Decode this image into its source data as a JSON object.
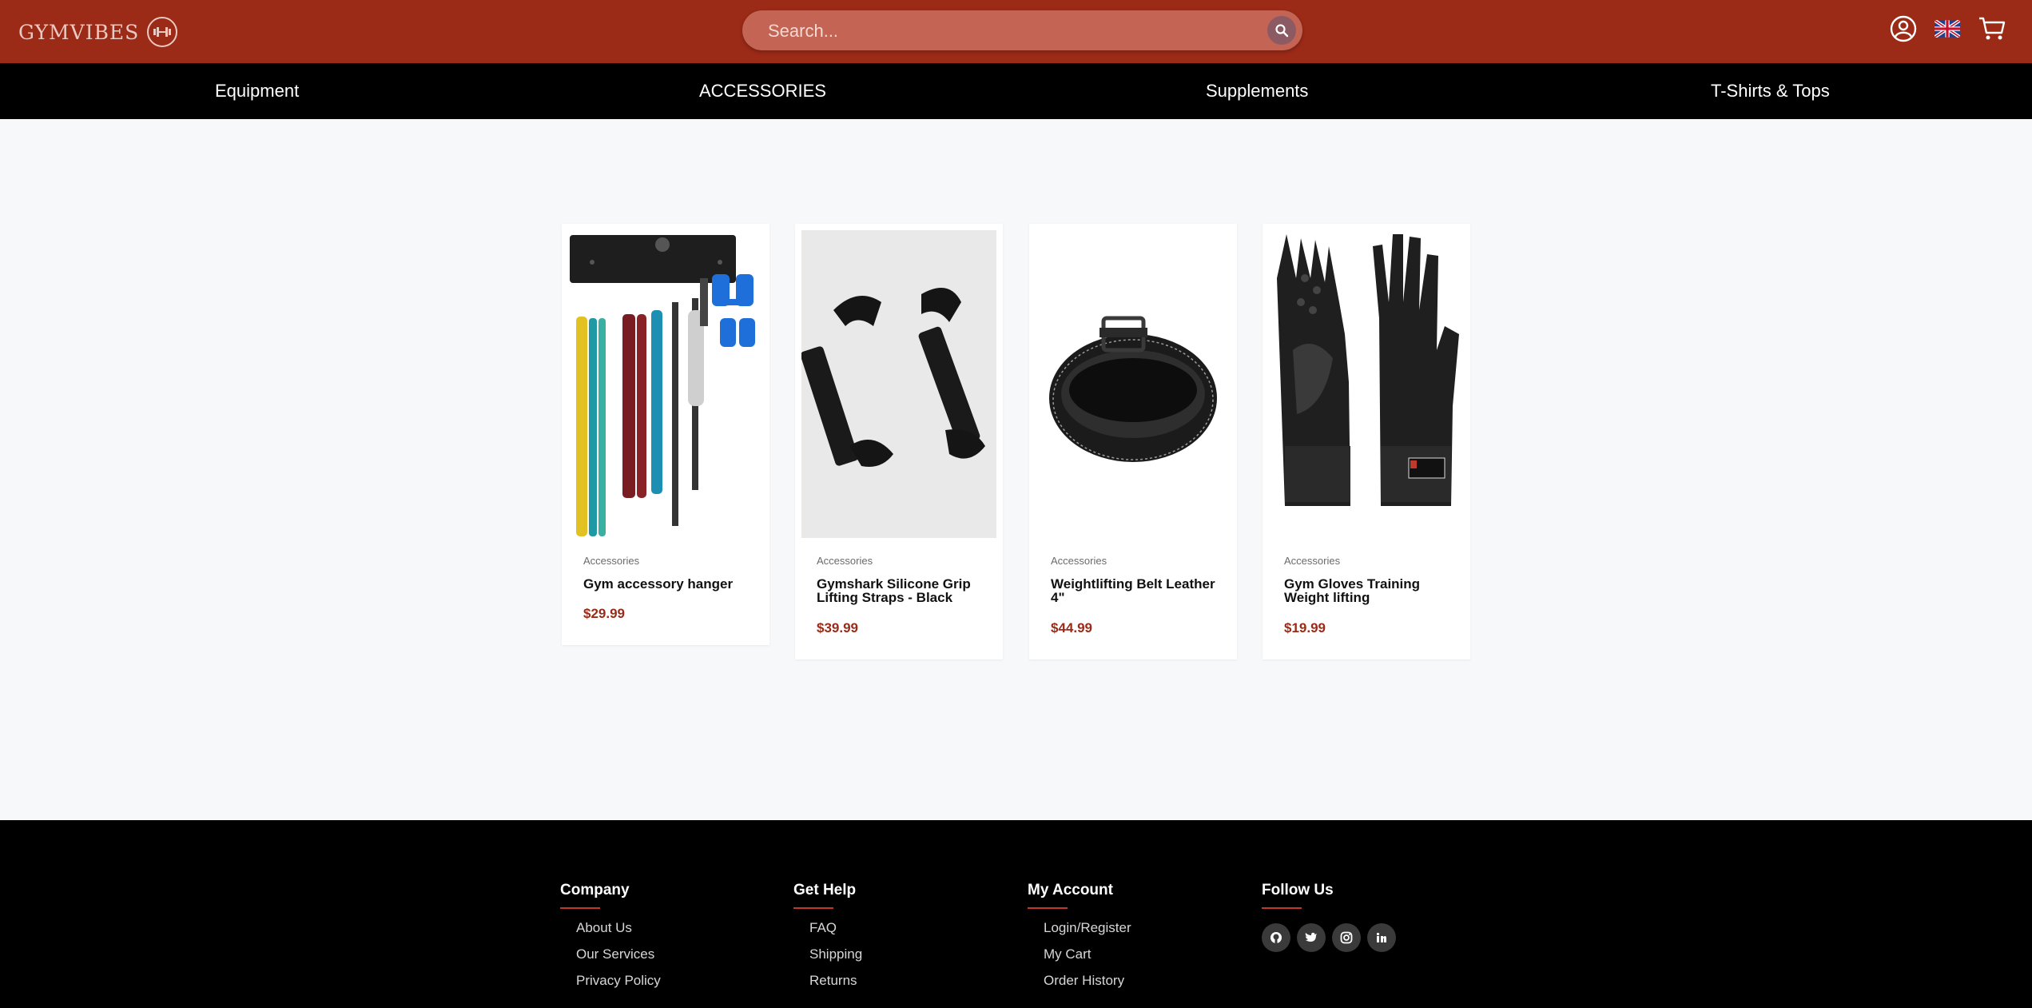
{
  "header": {
    "brand": "GYMVIBES",
    "search_placeholder": "Search...",
    "icons": [
      "user-icon",
      "uk-flag-icon",
      "cart-icon"
    ]
  },
  "category_nav": [
    "Equipment",
    "ACCESSORIES",
    "Supplements",
    "T-Shirts & Tops"
  ],
  "products": [
    {
      "category": "Accessories",
      "name": "Gym accessory hanger",
      "price": "$29.99"
    },
    {
      "category": "Accessories",
      "name": "Gymshark Silicone Grip Lifting Straps - Black",
      "price": "$39.99"
    },
    {
      "category": "Accessories",
      "name": "Weightlifting Belt Leather 4\"",
      "price": "$44.99"
    },
    {
      "category": "Accessories",
      "name": "Gym Gloves Training Weight lifting",
      "price": "$19.99"
    }
  ],
  "footer": {
    "company": {
      "title": "Company",
      "links": [
        "About Us",
        "Our Services",
        "Privacy Policy"
      ]
    },
    "get_help": {
      "title": "Get Help",
      "links": [
        "FAQ",
        "Shipping",
        "Returns"
      ]
    },
    "my_account": {
      "title": "My Account",
      "links": [
        "Login/Register",
        "My Cart",
        "Order History"
      ]
    },
    "follow_us": {
      "title": "Follow Us",
      "icons": [
        "github-icon",
        "twitter-icon",
        "instagram-icon",
        "linkedin-icon"
      ]
    }
  },
  "colors": {
    "header_bg": "#9b2a17",
    "nav_bg": "#000000",
    "price": "#9b2a17",
    "accent": "#c0392b"
  }
}
